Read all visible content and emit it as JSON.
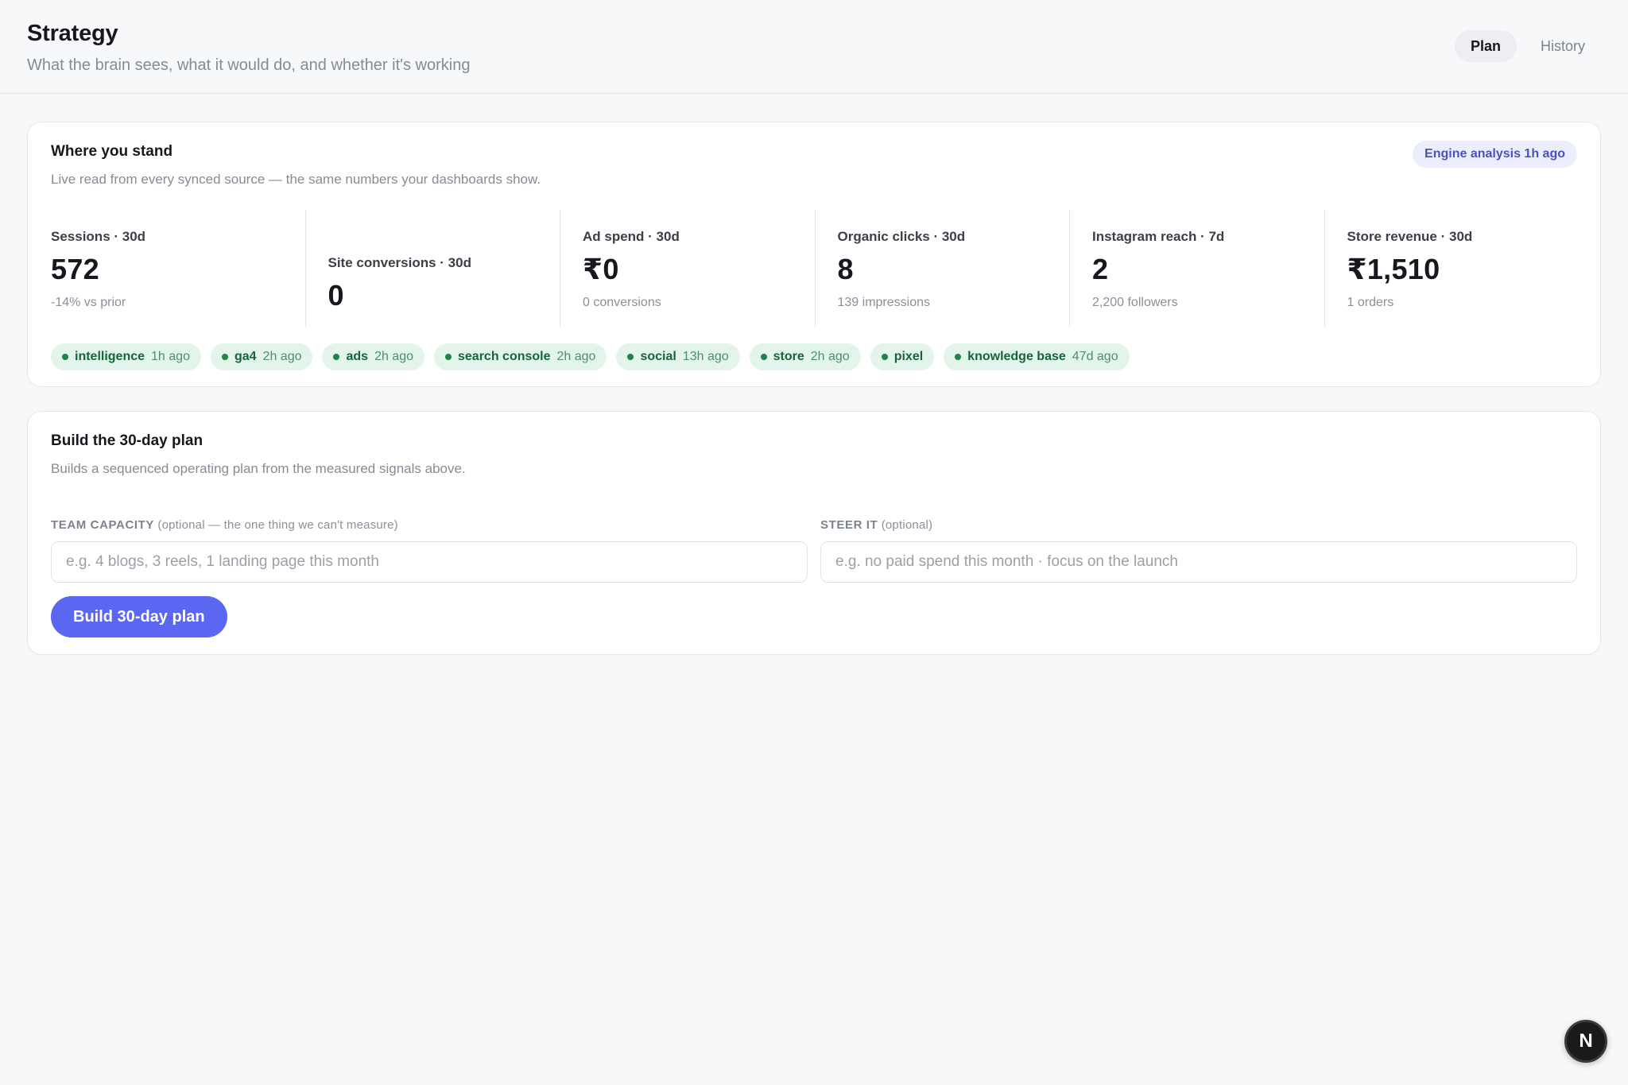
{
  "header": {
    "title": "Strategy",
    "subtitle": "What the brain sees, what it would do, and whether it's working",
    "tabs": [
      {
        "label": "Plan",
        "active": true
      },
      {
        "label": "History",
        "active": false
      }
    ]
  },
  "stand": {
    "title": "Where you stand",
    "description": "Live read from every synced source — the same numbers your dashboards show.",
    "badge": "Engine analysis 1h ago",
    "metrics": [
      {
        "label": "Sessions · 30d",
        "value": "572",
        "sub": "-14% vs prior"
      },
      {
        "label": "Site conversions · 30d",
        "value": "0",
        "sub": ""
      },
      {
        "label": "Ad spend · 30d",
        "value": "₹0",
        "sub": "0 conversions"
      },
      {
        "label": "Organic clicks · 30d",
        "value": "8",
        "sub": "139 impressions"
      },
      {
        "label": "Instagram reach · 7d",
        "value": "2",
        "sub": "2,200 followers"
      },
      {
        "label": "Store revenue · 30d",
        "value": "₹1,510",
        "sub": "1 orders"
      }
    ],
    "sources": [
      {
        "name": "intelligence",
        "age": "1h ago"
      },
      {
        "name": "ga4",
        "age": "2h ago"
      },
      {
        "name": "ads",
        "age": "2h ago"
      },
      {
        "name": "search console",
        "age": "2h ago"
      },
      {
        "name": "social",
        "age": "13h ago"
      },
      {
        "name": "store",
        "age": "2h ago"
      },
      {
        "name": "pixel",
        "age": ""
      },
      {
        "name": "knowledge base",
        "age": "47d ago"
      }
    ],
    "status_color": "#1e8449"
  },
  "plan": {
    "title": "Build the 30-day plan",
    "description": "Builds a sequenced operating plan from the measured signals above.",
    "capacity": {
      "label": "TEAM CAPACITY",
      "hint": "(optional — the one thing we can't measure)",
      "value": "",
      "placeholder": "e.g. 4 blogs, 3 reels, 1 landing page this month"
    },
    "steer": {
      "label": "STEER IT",
      "hint": "(optional)",
      "value": "",
      "placeholder": "e.g. no paid spend this month · focus on the launch"
    },
    "button_label": "Build 30-day plan",
    "accent_color": "#5b67f0"
  },
  "fab": {
    "letter": "N"
  }
}
